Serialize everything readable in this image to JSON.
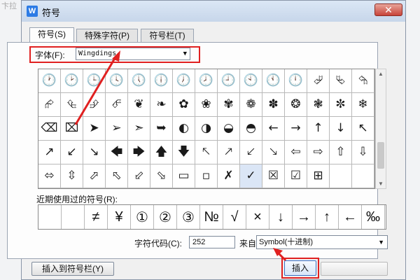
{
  "background": {
    "text": "卞拉"
  },
  "dialog": {
    "title": "符号",
    "close_label": "✕",
    "app_icon": "W"
  },
  "tabs": [
    {
      "label": "符号(S)",
      "active": true
    },
    {
      "label": "特殊字符(P)",
      "active": false
    },
    {
      "label": "符号栏(T)",
      "active": false
    }
  ],
  "font": {
    "label": "字体(F):",
    "value": "Wingdings"
  },
  "symbols": [
    [
      "🕐",
      "🕑",
      "🕒",
      "🕓",
      "🕔",
      "🕕",
      "🕖",
      "🕗",
      "🕘",
      "🕙",
      "🕚",
      "🕛",
      "⮰",
      "⮱",
      "⮲"
    ],
    [
      "⮳",
      "⮴",
      "⮵",
      "⮶",
      "❦",
      "❧",
      "✿",
      "❀",
      "✾",
      "❁",
      "✽",
      "❂",
      "❃",
      "✼",
      "❄"
    ],
    [
      "⌫",
      "⌧",
      "➤",
      "➢",
      "➣",
      "➥",
      "◐",
      "◑",
      "◒",
      "◓",
      "←",
      "→",
      "↑",
      "↓",
      "↖"
    ],
    [
      "↗",
      "↙",
      "↘",
      "🡄",
      "🡆",
      "🡅",
      "🡇",
      "🡔",
      "🡕",
      "🡗",
      "🡖",
      "⇦",
      "⇨",
      "⇧",
      "⇩"
    ],
    [
      "⬄",
      "⇳",
      "⬀",
      "⬁",
      "⬃",
      "⬂",
      "▭",
      "▫",
      "✗",
      "✓",
      "☒",
      "☑",
      "⊞",
      "",
      ""
    ]
  ],
  "selected_symbol": "✓",
  "recent": {
    "label": "近期使用过的符号(R):",
    "items": [
      "",
      "",
      "≠",
      "¥",
      "①",
      "②",
      "③",
      "№",
      "√",
      "×",
      "↓",
      "→",
      "↑",
      "←",
      "‰"
    ]
  },
  "code": {
    "label": "字符代码(C):",
    "value": "252",
    "from_label": "来自(M)",
    "from_value": "Symbol(十进制)"
  },
  "buttons": {
    "insert_to_bar": "插入到符号栏(Y)",
    "insert": "插入"
  },
  "colors": {
    "annotation": "#e02020"
  }
}
